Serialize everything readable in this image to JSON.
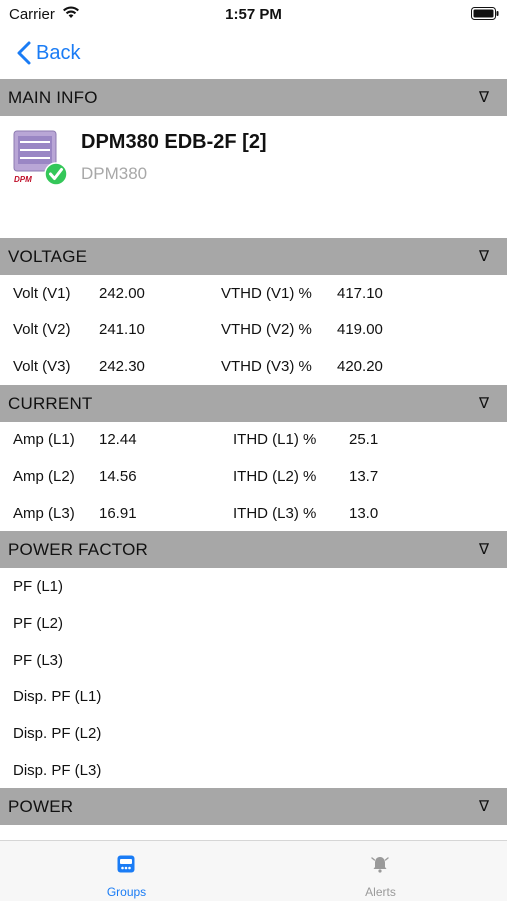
{
  "status_bar": {
    "carrier": "Carrier",
    "time": "1:57 PM"
  },
  "nav": {
    "back_label": "Back"
  },
  "sections": {
    "main_info": "MAIN INFO",
    "voltage": "VOLTAGE",
    "current": "CURRENT",
    "power_factor": "POWER FACTOR",
    "power": "POWER",
    "toggle_glyph": "∇"
  },
  "device": {
    "name": "DPM380 EDB-2F [2]",
    "model": "DPM380",
    "icon_badge": "DPM"
  },
  "voltage_rows": [
    {
      "label": "Volt (V1)",
      "value": "242.00",
      "thd_label": "VTHD (V1) %",
      "thd_value": "417.10"
    },
    {
      "label": "Volt (V2)",
      "value": "241.10",
      "thd_label": "VTHD (V2) %",
      "thd_value": "419.00"
    },
    {
      "label": "Volt (V3)",
      "value": "242.30",
      "thd_label": "VTHD (V3) %",
      "thd_value": "420.20"
    }
  ],
  "current_rows": [
    {
      "label": "Amp (L1)",
      "value": "12.44",
      "thd_label": "ITHD (L1) %",
      "thd_value": "25.1"
    },
    {
      "label": "Amp (L2)",
      "value": "14.56",
      "thd_label": "ITHD (L2) %",
      "thd_value": "13.7"
    },
    {
      "label": "Amp (L3)",
      "value": "16.91",
      "thd_label": "ITHD (L3) %",
      "thd_value": "13.0"
    }
  ],
  "pf_rows": [
    "PF (L1)",
    "PF (L2)",
    "PF (L3)",
    "Disp. PF (L1)",
    "Disp. PF (L2)",
    "Disp. PF (L3)"
  ],
  "tabs": {
    "groups": "Groups",
    "alerts": "Alerts"
  },
  "colors": {
    "accent": "#1a7cf5",
    "header_bg": "#a7a7a7",
    "check": "#34c759",
    "inactive_tab": "#9a9a9a"
  }
}
